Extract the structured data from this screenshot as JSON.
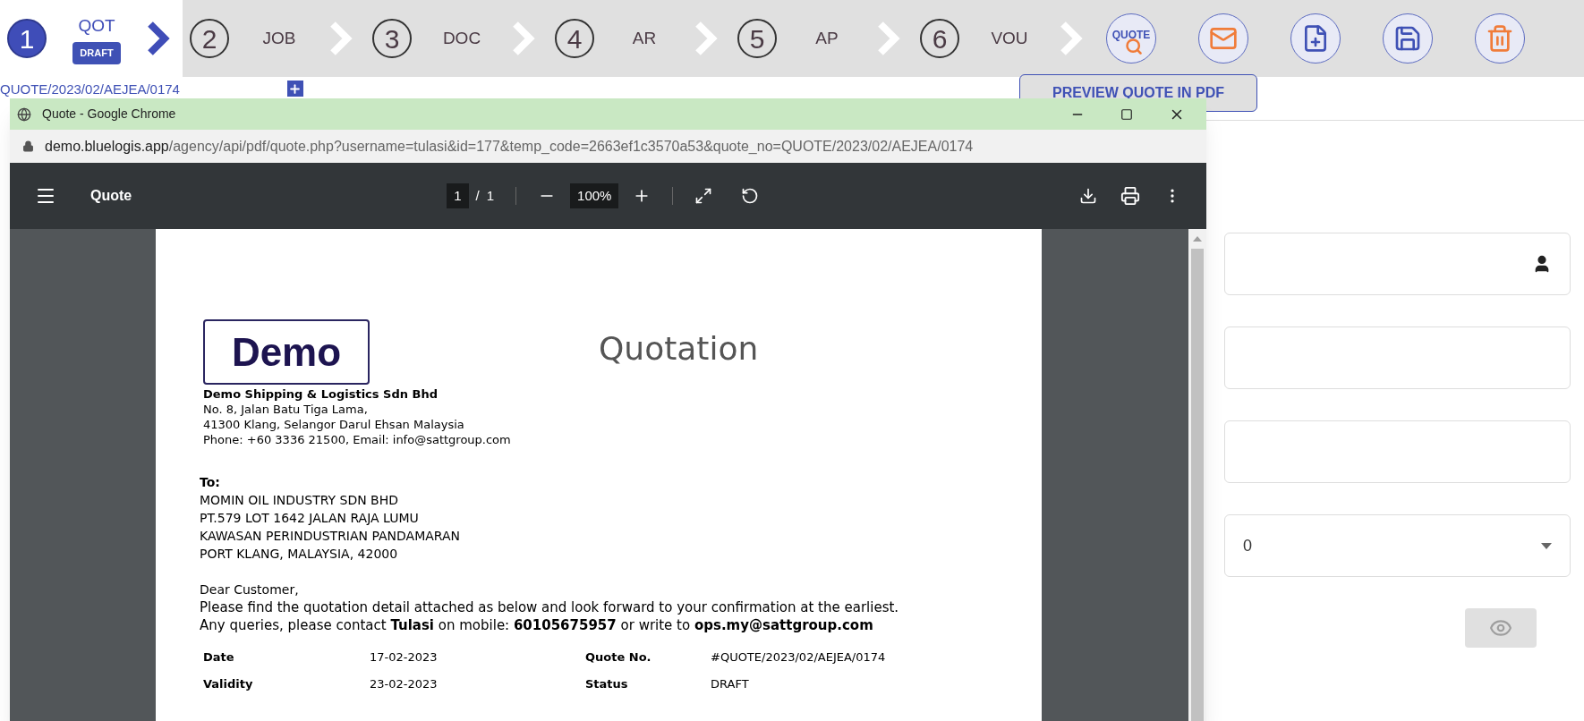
{
  "steps": [
    {
      "number": "1",
      "label": "QOT",
      "badge": "DRAFT",
      "selected": true
    },
    {
      "number": "2",
      "label": "JOB",
      "selected": false
    },
    {
      "number": "3",
      "label": "DOC",
      "selected": false
    },
    {
      "number": "4",
      "label": "AR",
      "selected": false
    },
    {
      "number": "5",
      "label": "AP",
      "selected": false
    },
    {
      "number": "6",
      "label": "VOU",
      "selected": false
    }
  ],
  "actions": [
    {
      "kind": "preview",
      "label": "QUOTE"
    },
    {
      "kind": "email"
    },
    {
      "kind": "new"
    },
    {
      "kind": "save"
    },
    {
      "kind": "delete"
    }
  ],
  "tooltip": "PREVIEW QUOTE IN PDF",
  "quote_ref": "QUOTE/2023/02/AEJEA/0174",
  "browser": {
    "title": "Quote - Google Chrome",
    "url_host": "demo.bluelogis.app",
    "url_path": "/agency/api/pdf/quote.php?username=tulasi&id=177&temp_code=2663ef1c3570a53&quote_no=QUOTE/2023/02/AEJEA/0174"
  },
  "pdf_toolbar": {
    "title": "Quote",
    "page": "1",
    "separator": "/",
    "pages": "1",
    "zoom": "100%"
  },
  "document": {
    "logo": "Demo",
    "heading": "Quotation",
    "company": "Demo Shipping & Logistics Sdn Bhd",
    "address": [
      "No. 8, Jalan Batu Tiga Lama,",
      "41300 Klang, Selangor Darul Ehsan Malaysia",
      "Phone: +60 3336 21500, Email: info@sattgroup.com"
    ],
    "to_label": "To:",
    "recipient": [
      "MOMIN OIL INDUSTRY SDN BHD",
      "PT.579 LOT 1642 JALAN RAJA LUMU",
      "KAWASAN PERINDUSTRIAN PANDAMARAN",
      "PORT KLANG, MALAYSIA, 42000"
    ],
    "greeting": "Dear Customer,",
    "body": [
      "Please find the quotation detail attached as below and look forward to your confirmation at the earliest.",
      "Any queries, please contact **Tulasi** on mobile: **60105675957** or write to **ops.my@sattgroup.com**"
    ],
    "meta": [
      {
        "label": "Date",
        "value": "17-02-2023",
        "label_2": "Quote No.",
        "value_2": "#QUOTE/2023/02/AEJEA/0174"
      },
      {
        "label": "Validity",
        "value": "23-02-2023",
        "label_2": "Status",
        "value_2": "DRAFT"
      }
    ]
  },
  "form": {
    "fields": [
      {
        "kind": "person"
      },
      {
        "kind": "text"
      },
      {
        "kind": "text"
      },
      {
        "kind": "select",
        "value": "0"
      }
    ],
    "view_button": {
      "disabled": true
    }
  }
}
